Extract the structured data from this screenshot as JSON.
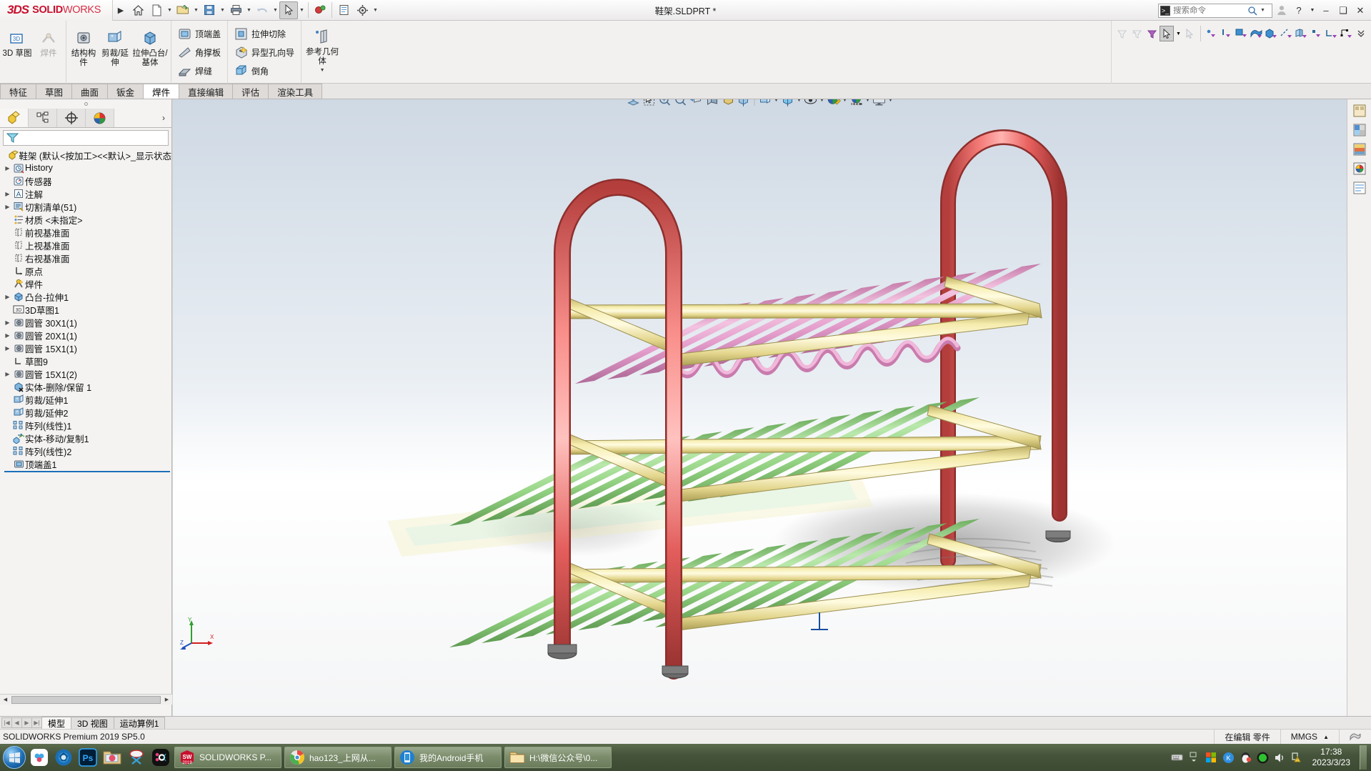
{
  "app": {
    "brand_ds": "3DS",
    "brand_name_bold": "SOLID",
    "brand_name_light": "WORKS",
    "document_title": "鞋架.SLDPRT *",
    "accent_red": "#c8102e"
  },
  "titlebar": {
    "quick_access": [
      {
        "name": "home-icon",
        "label": "主页"
      },
      {
        "name": "new-document-icon",
        "label": "新建"
      },
      {
        "name": "open-folder-icon",
        "label": "打开"
      },
      {
        "name": "save-icon",
        "label": "保存"
      },
      {
        "name": "print-icon",
        "label": "打印"
      },
      {
        "name": "undo-icon",
        "label": "撤销"
      },
      {
        "name": "select-cursor-icon",
        "label": "选择"
      },
      {
        "name": "rebuild-icon",
        "label": "重建模型"
      },
      {
        "name": "drawing-icon",
        "label": "工程图"
      },
      {
        "name": "options-gear-icon",
        "label": "选项"
      }
    ],
    "search_placeholder": "搜索命令",
    "window_buttons": [
      "user",
      "help",
      "minimize",
      "restore",
      "close"
    ]
  },
  "ribbon": {
    "groups": [
      {
        "name": "sketch-group",
        "big_buttons": [
          {
            "label": "3D 草图",
            "icon": "3d-sketch-icon",
            "disabled": false
          },
          {
            "label": "焊件",
            "icon": "weldment-icon",
            "disabled": true
          }
        ]
      },
      {
        "name": "weldment-group",
        "big_buttons": [
          {
            "label": "结构构件",
            "icon": "structural-member-icon",
            "disabled": false
          },
          {
            "label": "剪裁/延伸",
            "icon": "trim-extend-icon",
            "disabled": false
          },
          {
            "label": "拉伸凸台/基体",
            "icon": "extrude-boss-icon",
            "disabled": false
          }
        ]
      },
      {
        "name": "weldment-small-group",
        "small_buttons": [
          {
            "label": "顶端盖",
            "icon": "end-cap-icon"
          },
          {
            "label": "角撑板",
            "icon": "gusset-icon"
          },
          {
            "label": "焊缝",
            "icon": "weld-bead-icon"
          }
        ]
      },
      {
        "name": "feature-small-group",
        "small_buttons": [
          {
            "label": "拉伸切除",
            "icon": "extruded-cut-icon"
          },
          {
            "label": "异型孔向导",
            "icon": "hole-wizard-icon"
          },
          {
            "label": "倒角",
            "icon": "chamfer-icon"
          }
        ]
      },
      {
        "name": "reference-group",
        "big_buttons": [
          {
            "label": "参考几何体",
            "icon": "reference-geometry-icon",
            "disabled": false
          }
        ]
      }
    ],
    "selection_filter": [
      {
        "name": "filter-off-icon",
        "disabled": true
      },
      {
        "name": "filter-clear-icon",
        "disabled": true
      },
      {
        "name": "filter-purple-icon",
        "disabled": false
      },
      {
        "name": "select-arrow-icon",
        "selected": true
      },
      {
        "name": "select-other-icon",
        "disabled": true
      },
      {
        "name": "filter-vertex-icon",
        "disabled": false
      },
      {
        "name": "filter-edge-icon",
        "disabled": false
      },
      {
        "name": "filter-face-icon",
        "disabled": false
      },
      {
        "name": "filter-surface-icon",
        "disabled": false
      },
      {
        "name": "filter-solid-body-icon",
        "disabled": false
      },
      {
        "name": "filter-axis-icon",
        "disabled": false
      },
      {
        "name": "filter-plane-icon",
        "disabled": false
      },
      {
        "name": "filter-point-icon",
        "disabled": false
      },
      {
        "name": "filter-sketch-icon",
        "disabled": false
      },
      {
        "name": "filter-dimension-icon",
        "disabled": false
      },
      {
        "name": "filter-expand-icon",
        "disabled": false
      }
    ]
  },
  "tabs": [
    {
      "label": "特征",
      "active": false
    },
    {
      "label": "草图",
      "active": false
    },
    {
      "label": "曲面",
      "active": false
    },
    {
      "label": "钣金",
      "active": false
    },
    {
      "label": "焊件",
      "active": true
    },
    {
      "label": "直接编辑",
      "active": false
    },
    {
      "label": "评估",
      "active": false
    },
    {
      "label": "渲染工具",
      "active": false
    }
  ],
  "left_panel": {
    "panel_tabs": [
      {
        "name": "feature-manager-tab",
        "icon": "feature-tree-icon",
        "active": true
      },
      {
        "name": "property-manager-tab",
        "icon": "property-manager-icon",
        "active": false
      },
      {
        "name": "configuration-manager-tab",
        "icon": "configuration-icon",
        "active": false
      },
      {
        "name": "display-manager-tab",
        "icon": "display-manager-icon",
        "active": false
      }
    ],
    "filter_placeholder": "",
    "tree": [
      {
        "label": "鞋架  (默认<按加工><<默认>_显示状态",
        "icon": "part-icon",
        "expandable": false,
        "indent": 0,
        "root": true
      },
      {
        "label": "History",
        "icon": "history-icon",
        "expandable": true,
        "indent": 1
      },
      {
        "label": "传感器",
        "icon": "sensor-icon",
        "expandable": false,
        "indent": 1
      },
      {
        "label": "注解",
        "icon": "annotations-icon",
        "expandable": true,
        "indent": 1
      },
      {
        "label": "切割清单(51)",
        "icon": "cut-list-icon",
        "expandable": true,
        "indent": 1
      },
      {
        "label": "材质 <未指定>",
        "icon": "material-icon",
        "expandable": false,
        "indent": 1
      },
      {
        "label": "前视基准面",
        "icon": "plane-icon",
        "expandable": false,
        "indent": 1
      },
      {
        "label": "上视基准面",
        "icon": "plane-icon",
        "expandable": false,
        "indent": 1
      },
      {
        "label": "右视基准面",
        "icon": "plane-icon",
        "expandable": false,
        "indent": 1
      },
      {
        "label": "原点",
        "icon": "origin-icon",
        "expandable": false,
        "indent": 1
      },
      {
        "label": "焊件",
        "icon": "weldment-feature-icon",
        "expandable": false,
        "indent": 1
      },
      {
        "label": "凸台-拉伸1",
        "icon": "boss-extrude-icon",
        "expandable": true,
        "indent": 1
      },
      {
        "label": "3D草图1",
        "icon": "3d-sketch-tree-icon",
        "expandable": false,
        "indent": 1
      },
      {
        "label": "圆管 30X1(1)",
        "icon": "pipe-icon",
        "expandable": true,
        "indent": 1
      },
      {
        "label": "圆管 20X1(1)",
        "icon": "pipe-icon",
        "expandable": true,
        "indent": 1
      },
      {
        "label": "圆管 15X1(1)",
        "icon": "pipe-icon",
        "expandable": true,
        "indent": 1
      },
      {
        "label": "草图9",
        "icon": "sketch-icon",
        "expandable": false,
        "indent": 1
      },
      {
        "label": "圆管 15X1(2)",
        "icon": "pipe-icon",
        "expandable": true,
        "indent": 1
      },
      {
        "label": "实体-删除/保留 1",
        "icon": "delete-body-icon",
        "expandable": false,
        "indent": 1
      },
      {
        "label": "剪裁/延伸1",
        "icon": "trim-extend-tree-icon",
        "expandable": false,
        "indent": 1
      },
      {
        "label": "剪裁/延伸2",
        "icon": "trim-extend-tree-icon",
        "expandable": false,
        "indent": 1
      },
      {
        "label": "阵列(线性)1",
        "icon": "linear-pattern-icon",
        "expandable": false,
        "indent": 1
      },
      {
        "label": "实体-移动/复制1",
        "icon": "move-copy-body-icon",
        "expandable": false,
        "indent": 1
      },
      {
        "label": "阵列(线性)2",
        "icon": "linear-pattern-icon",
        "expandable": false,
        "indent": 1
      },
      {
        "label": "顶端盖1",
        "icon": "end-cap-tree-icon",
        "expandable": false,
        "indent": 1
      }
    ]
  },
  "viewport": {
    "heads_up_tools": [
      {
        "name": "zoom-to-fit-icon",
        "caret": false
      },
      {
        "name": "zoom-to-area-icon",
        "caret": false
      },
      {
        "name": "previous-view-icon",
        "caret": false
      },
      {
        "name": "zoom-icon",
        "caret": false
      },
      {
        "name": "section-view-icon",
        "caret": false
      },
      {
        "name": "view-orientation-icon",
        "caret": false
      },
      {
        "name": "display-style-icon",
        "caret": true
      },
      {
        "name": "view-cube-icon",
        "caret": false
      },
      {
        "name": "hide-show-items-icon",
        "caret": true
      },
      {
        "name": "apply-scene-icon",
        "caret": true
      },
      {
        "name": "view-settings-icon",
        "caret": true
      },
      {
        "name": "appearance-icon",
        "caret": true
      },
      {
        "name": "scene-icon",
        "caret": true
      },
      {
        "name": "display-monitor-icon",
        "caret": true
      }
    ],
    "window_controls": [
      "restore-left",
      "minimize",
      "restore",
      "close"
    ],
    "triad_labels": {
      "x": "X",
      "y": "Y",
      "z": "Z"
    },
    "model": {
      "name": "鞋架",
      "description": "三层鞋架焊件模型",
      "colors": {
        "frame": "#e8615f",
        "frame_dark": "#b8413f",
        "rail": "#f0e6a0",
        "rail_dark": "#cfc277",
        "slat_green": "#a8e39a",
        "slat_green_dark": "#78bd68",
        "slat_pink": "#e9a7cf",
        "slat_pink_dark": "#c97bad",
        "foot": "#5a5a5a"
      }
    }
  },
  "right_toolbar": [
    {
      "name": "view-palette-icon"
    },
    {
      "name": "appearances-icon"
    },
    {
      "name": "scenes-icon"
    },
    {
      "name": "decals-icon"
    },
    {
      "name": "custom-properties-icon"
    }
  ],
  "bottom_tabs": [
    {
      "label": "模型",
      "active": true
    },
    {
      "label": "3D 视图",
      "active": false
    },
    {
      "label": "运动算例1",
      "active": false
    }
  ],
  "statusbar": {
    "left_text": "SOLIDWORKS Premium 2019 SP5.0",
    "edit_state": "在编辑 零件",
    "units": "MMGS"
  },
  "taskbar": {
    "start_label": "开始",
    "quick_launch": [
      {
        "name": "cloud-sync-icon"
      },
      {
        "name": "camera-lens-icon"
      },
      {
        "name": "photoshop-icon",
        "label": "Ps"
      },
      {
        "name": "picture-folder-icon"
      },
      {
        "name": "snipping-tool-icon"
      },
      {
        "name": "ok-app-icon"
      }
    ],
    "windows": [
      {
        "name": "solidworks-window",
        "label": "SOLIDWORKS P...",
        "icon": "solidworks-icon",
        "active": true
      },
      {
        "name": "browser-window",
        "label": "hao123_上网从...",
        "icon": "chrome-icon",
        "active": false
      },
      {
        "name": "android-phone-window",
        "label": "我的Android手机",
        "icon": "phone-icon",
        "active": false
      },
      {
        "name": "explorer-window",
        "label": "H:\\微信公众号\\0...",
        "icon": "folder-icon",
        "active": false
      }
    ],
    "tray_icons": [
      {
        "name": "keyboard-icon"
      },
      {
        "name": "show-hidden-icons-icon"
      },
      {
        "name": "windows-flag-icon"
      },
      {
        "name": "kingsoft-icon"
      },
      {
        "name": "qq-icon"
      },
      {
        "name": "green-circle-icon"
      },
      {
        "name": "volume-icon"
      },
      {
        "name": "action-center-warning-icon"
      }
    ],
    "clock_time": "17:38",
    "clock_date": "2023/3/23"
  }
}
